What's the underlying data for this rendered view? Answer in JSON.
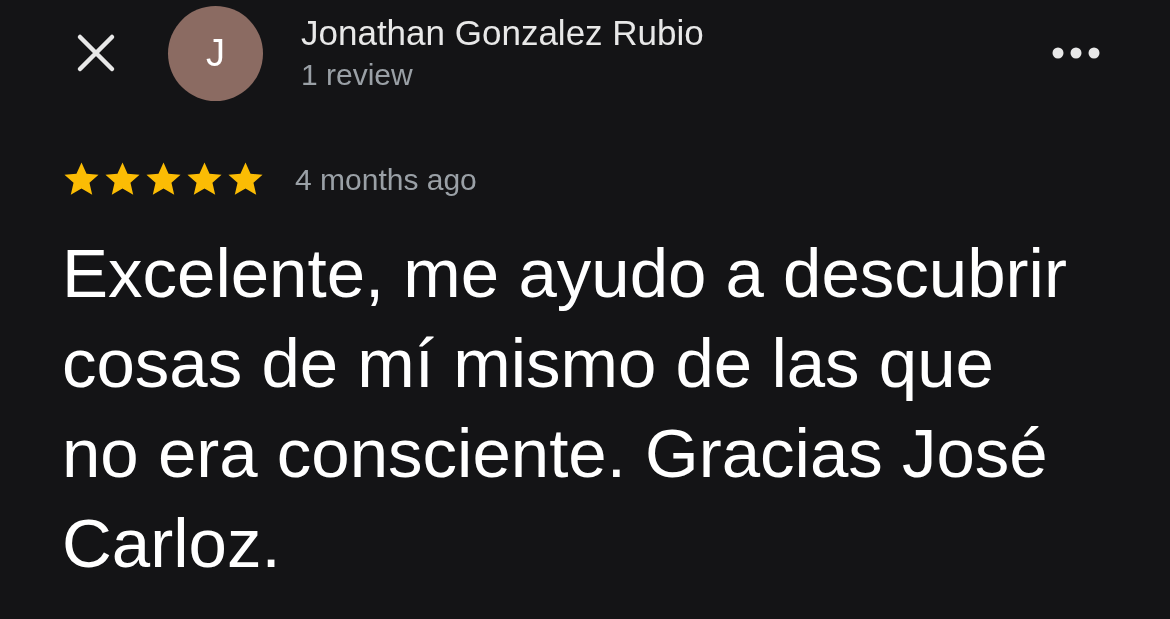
{
  "reviewer": {
    "initial": "J",
    "name": "Jonathan Gonzalez Rubio",
    "review_count": "1 review"
  },
  "review": {
    "stars": 5,
    "time": "4 months ago",
    "text": "Excelente, me ayudo a descubrir cosas de mí mismo de las que no era consciente. Gracias José Carloz."
  }
}
